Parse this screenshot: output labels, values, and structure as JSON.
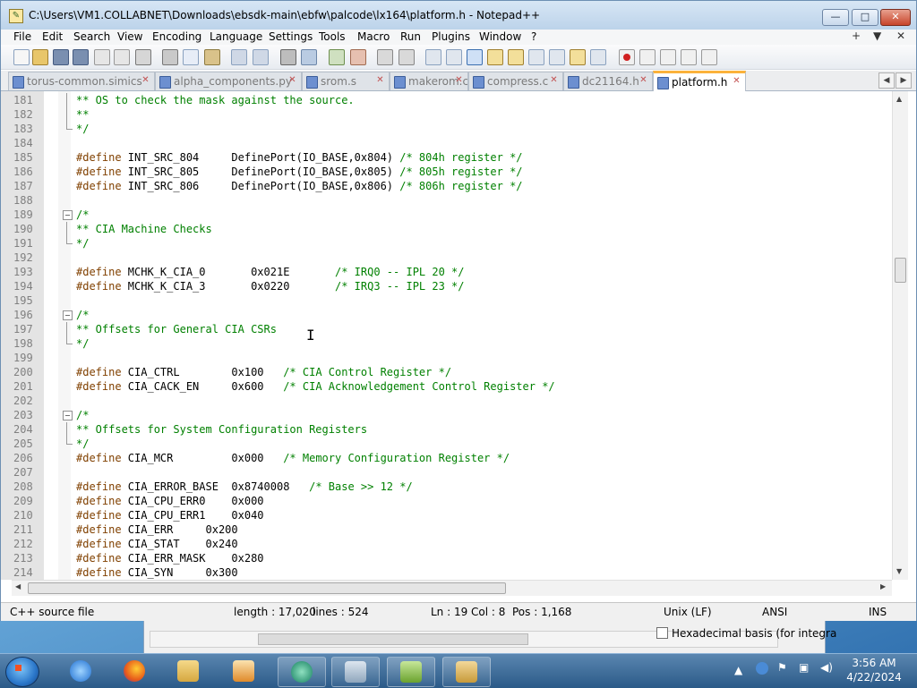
{
  "window": {
    "title": "C:\\Users\\VM1.COLLABNET\\Downloads\\ebsdk-main\\ebfw\\palcode\\lx164\\platform.h - Notepad++",
    "buttons": {
      "minimize": "—",
      "maximize": "□",
      "close": "✕"
    }
  },
  "menu": {
    "items": [
      "File",
      "Edit",
      "Search",
      "View",
      "Encoding",
      "Language",
      "Settings",
      "Tools",
      "Macro",
      "Run",
      "Plugins",
      "Window",
      "?"
    ],
    "right": [
      "+",
      "▼",
      "✕"
    ]
  },
  "tabs": [
    {
      "label": "torus-common.simics"
    },
    {
      "label": "alpha_components.py"
    },
    {
      "label": "srom.s"
    },
    {
      "label": "makerom.c"
    },
    {
      "label": "compress.c"
    },
    {
      "label": "dc21164.h"
    },
    {
      "label": "platform.h",
      "active": true
    }
  ],
  "tab_nav": {
    "left": "◀",
    "right": "▶"
  },
  "colors": {
    "comment": "#008000",
    "preproc": "#804000",
    "active_tab_accent": "#fbb23b"
  },
  "editor": {
    "lines": [
      {
        "n": "181",
        "pre": "",
        "rest": "** OS to check the mask against the source.",
        "kind": "comment"
      },
      {
        "n": "182",
        "pre": "",
        "rest": "**",
        "kind": "comment"
      },
      {
        "n": "183",
        "pre": "",
        "rest": "*/",
        "kind": "comment",
        "foldEnd": true
      },
      {
        "n": "184",
        "pre": "",
        "rest": "",
        "kind": "blank"
      },
      {
        "n": "185",
        "pre": "#define",
        "rest": " INT_SRC_804     DefinePort(IO_BASE,0x804) ",
        "cmt": "/* 804h register */",
        "kind": "define"
      },
      {
        "n": "186",
        "pre": "#define",
        "rest": " INT_SRC_805     DefinePort(IO_BASE,0x805) ",
        "cmt": "/* 805h register */",
        "kind": "define"
      },
      {
        "n": "187",
        "pre": "#define",
        "rest": " INT_SRC_806     DefinePort(IO_BASE,0x806) ",
        "cmt": "/* 806h register */",
        "kind": "define"
      },
      {
        "n": "188",
        "pre": "",
        "rest": "",
        "kind": "blank"
      },
      {
        "n": "189",
        "pre": "",
        "rest": "/*",
        "kind": "comment",
        "foldStart": true
      },
      {
        "n": "190",
        "pre": "",
        "rest": "** CIA Machine Checks",
        "kind": "comment"
      },
      {
        "n": "191",
        "pre": "",
        "rest": "*/",
        "kind": "comment",
        "foldEnd": true
      },
      {
        "n": "192",
        "pre": "",
        "rest": "",
        "kind": "blank"
      },
      {
        "n": "193",
        "pre": "#define",
        "rest": " MCHK_K_CIA_0       0x021E       ",
        "cmt": "/* IRQ0 -- IPL 20 */",
        "kind": "define"
      },
      {
        "n": "194",
        "pre": "#define",
        "rest": " MCHK_K_CIA_3       0x0220       ",
        "cmt": "/* IRQ3 -- IPL 23 */",
        "kind": "define"
      },
      {
        "n": "195",
        "pre": "",
        "rest": "",
        "kind": "blank"
      },
      {
        "n": "196",
        "pre": "",
        "rest": "/*",
        "kind": "comment",
        "foldStart": true
      },
      {
        "n": "197",
        "pre": "",
        "rest": "** Offsets for General CIA CSRs",
        "kind": "comment"
      },
      {
        "n": "198",
        "pre": "",
        "rest": "*/",
        "kind": "comment",
        "foldEnd": true
      },
      {
        "n": "199",
        "pre": "",
        "rest": "",
        "kind": "blank"
      },
      {
        "n": "200",
        "pre": "#define",
        "rest": " CIA_CTRL        0x100   ",
        "cmt": "/* CIA Control Register */",
        "kind": "define"
      },
      {
        "n": "201",
        "pre": "#define",
        "rest": " CIA_CACK_EN     0x600   ",
        "cmt": "/* CIA Acknowledgement Control Register */",
        "kind": "define"
      },
      {
        "n": "202",
        "pre": "",
        "rest": "",
        "kind": "blank"
      },
      {
        "n": "203",
        "pre": "",
        "rest": "/*",
        "kind": "comment",
        "foldStart": true
      },
      {
        "n": "204",
        "pre": "",
        "rest": "** Offsets for System Configuration Registers",
        "kind": "comment"
      },
      {
        "n": "205",
        "pre": "",
        "rest": "*/",
        "kind": "comment",
        "foldEnd": true
      },
      {
        "n": "206",
        "pre": "#define",
        "rest": " CIA_MCR         0x000   ",
        "cmt": "/* Memory Configuration Register */",
        "kind": "define"
      },
      {
        "n": "207",
        "pre": "",
        "rest": "",
        "kind": "blank"
      },
      {
        "n": "208",
        "pre": "#define",
        "rest": " CIA_ERROR_BASE  0x8740008   ",
        "cmt": "/* Base >> 12 */",
        "kind": "define"
      },
      {
        "n": "209",
        "pre": "#define",
        "rest": " CIA_CPU_ERR0    0x000",
        "cmt": "",
        "kind": "define"
      },
      {
        "n": "210",
        "pre": "#define",
        "rest": " CIA_CPU_ERR1    0x040",
        "cmt": "",
        "kind": "define"
      },
      {
        "n": "211",
        "pre": "#define",
        "rest": " CIA_ERR     0x200",
        "cmt": "",
        "kind": "define"
      },
      {
        "n": "212",
        "pre": "#define",
        "rest": " CIA_STAT    0x240",
        "cmt": "",
        "kind": "define"
      },
      {
        "n": "213",
        "pre": "#define",
        "rest": " CIA_ERR_MASK    0x280",
        "cmt": "",
        "kind": "define"
      },
      {
        "n": "214",
        "pre": "#define",
        "rest": " CIA_SYN     0x300",
        "cmt": "",
        "kind": "define"
      }
    ]
  },
  "status": {
    "file_type": "C++ source file",
    "length": "length : 17,020",
    "lines": "lines : 524",
    "ln": "Ln : 19",
    "col": "Col : 8",
    "pos": "Pos : 1,168",
    "eol": "Unix (LF)",
    "encoding": "ANSI",
    "mode": "INS"
  },
  "background_window": {
    "checkbox_label": "Hexadecimal basis (for integra"
  },
  "taskbar": {
    "time": "3:56 AM",
    "date": "4/22/2024"
  }
}
